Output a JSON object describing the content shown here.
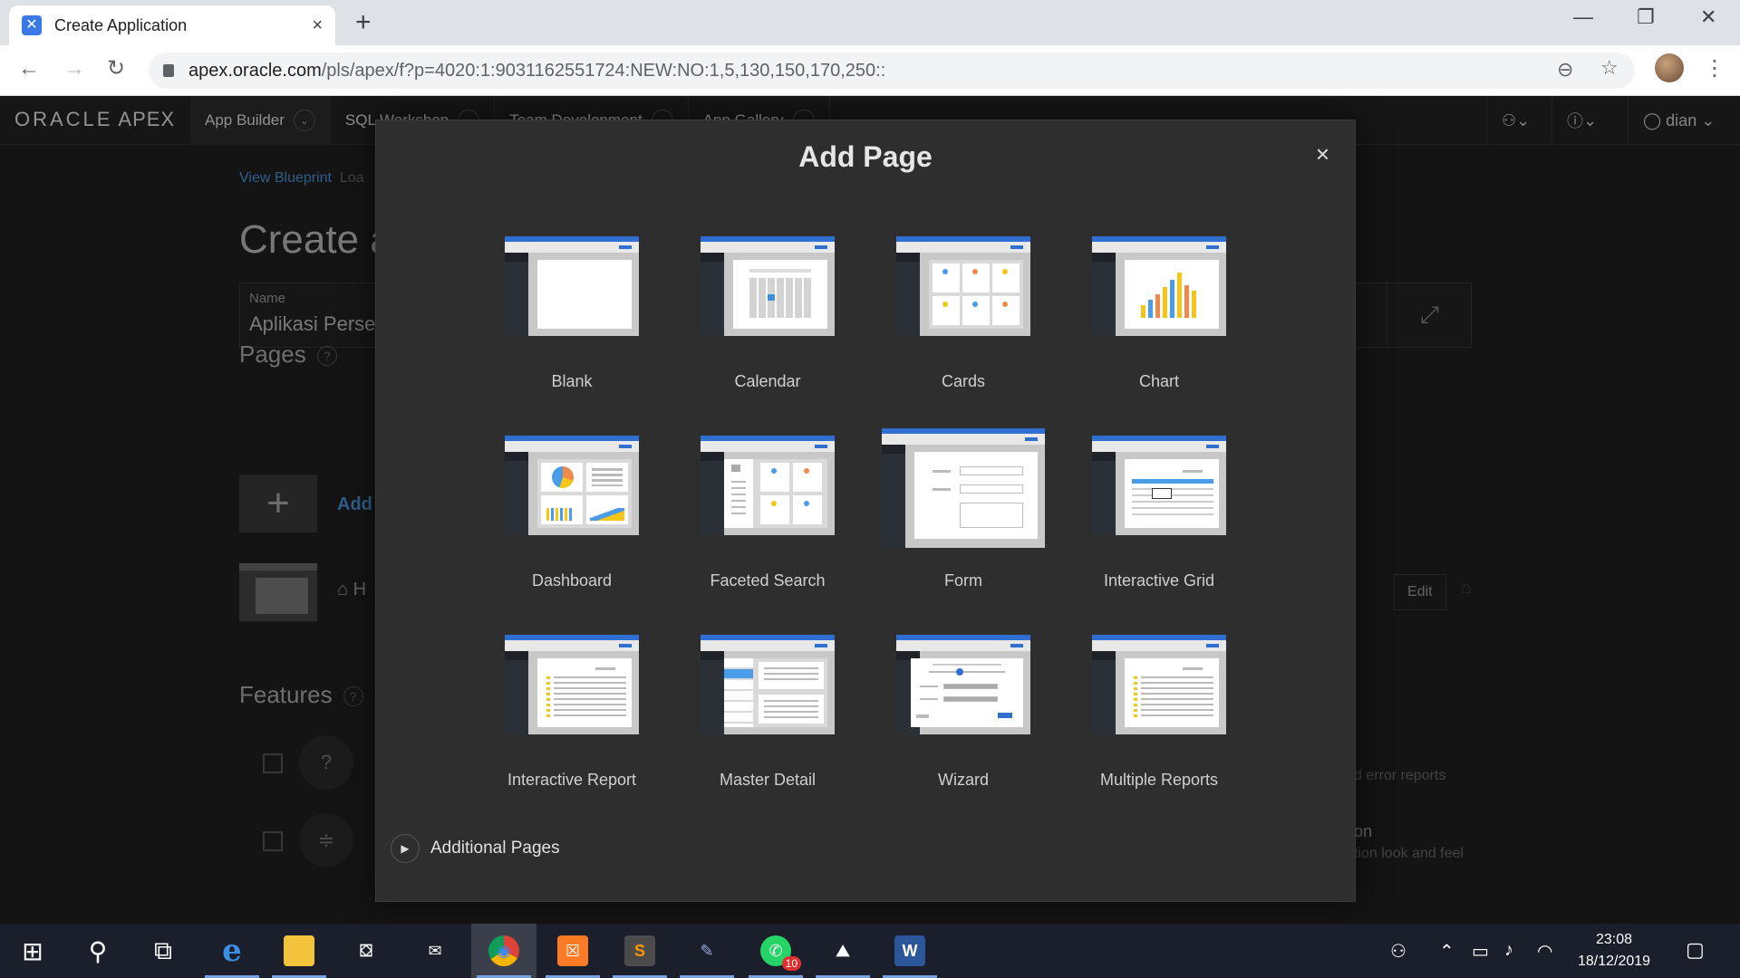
{
  "browser": {
    "tab_title": "Create Application",
    "tab_close": "×",
    "new_tab": "+",
    "url_host": "apex.oracle.com",
    "url_path": "/pls/apex/f?p=4020:1:9031162551724:NEW:NO:1,5,130,150,170,250::",
    "win_min": "—",
    "win_restore": "❐",
    "win_close": "✕",
    "back": "←",
    "forward": "→",
    "reload": "↻",
    "zoom": "⊖",
    "star": "☆",
    "menu": "⋮"
  },
  "apex": {
    "logo_brand": "ORACLE",
    "logo_product": "APEX",
    "nav": [
      {
        "label": "App Builder",
        "active": true
      },
      {
        "label": "SQL Workshop",
        "active": false
      },
      {
        "label": "Team Development",
        "active": false
      },
      {
        "label": "App Gallery",
        "active": false
      }
    ],
    "user": "dian",
    "chevron": "⌄"
  },
  "background": {
    "crumb_link": "View Blueprint",
    "crumb_rest": "Loa",
    "heading": "Create a",
    "name_label": "Name",
    "name_value": "Aplikasi Persec",
    "pages_heading": "Pages",
    "help_glyph": "?",
    "add_label": "Add",
    "add_glyph": "+",
    "home_label": "H",
    "edit_label": "Edit",
    "features_heading": "Features",
    "feat1_glyph": "?",
    "feat2_glyph": "≑",
    "right_text_1": "d error reports",
    "right_text_2": "on",
    "right_text_3": "tion look and feel"
  },
  "modal": {
    "title": "Add Page",
    "close": "×",
    "page_types": [
      {
        "label": "Blank"
      },
      {
        "label": "Calendar"
      },
      {
        "label": "Cards"
      },
      {
        "label": "Chart"
      },
      {
        "label": "Dashboard"
      },
      {
        "label": "Faceted Search"
      },
      {
        "label": "Form",
        "selected": true
      },
      {
        "label": "Interactive Grid"
      },
      {
        "label": "Interactive Report"
      },
      {
        "label": "Master Detail"
      },
      {
        "label": "Wizard"
      },
      {
        "label": "Multiple Reports"
      }
    ],
    "additional_label": "Additional Pages",
    "additional_glyph": "▶"
  },
  "taskbar": {
    "apps": [
      {
        "name": "start",
        "glyph": "⊞"
      },
      {
        "name": "search",
        "glyph": "⚲"
      },
      {
        "name": "task-view",
        "glyph": "⧉"
      },
      {
        "name": "edge",
        "glyph": "e"
      },
      {
        "name": "file-explorer",
        "glyph": "▬"
      },
      {
        "name": "store",
        "glyph": "⛋"
      },
      {
        "name": "mail",
        "glyph": "✉"
      },
      {
        "name": "chrome",
        "glyph": "◉"
      },
      {
        "name": "xampp",
        "glyph": "☒"
      },
      {
        "name": "sublime",
        "glyph": "S"
      },
      {
        "name": "paint",
        "glyph": "✎"
      },
      {
        "name": "whatsapp",
        "glyph": "✆"
      },
      {
        "name": "photos",
        "glyph": "⛰"
      },
      {
        "name": "word",
        "glyph": "W"
      }
    ],
    "whatsapp_badge": "10",
    "time": "23:08",
    "date": "18/12/2019"
  },
  "colors": {
    "accent_blue": "#2f6fd1",
    "link_blue": "#4a8fd6",
    "modal_bg": "#2e2e2e"
  }
}
